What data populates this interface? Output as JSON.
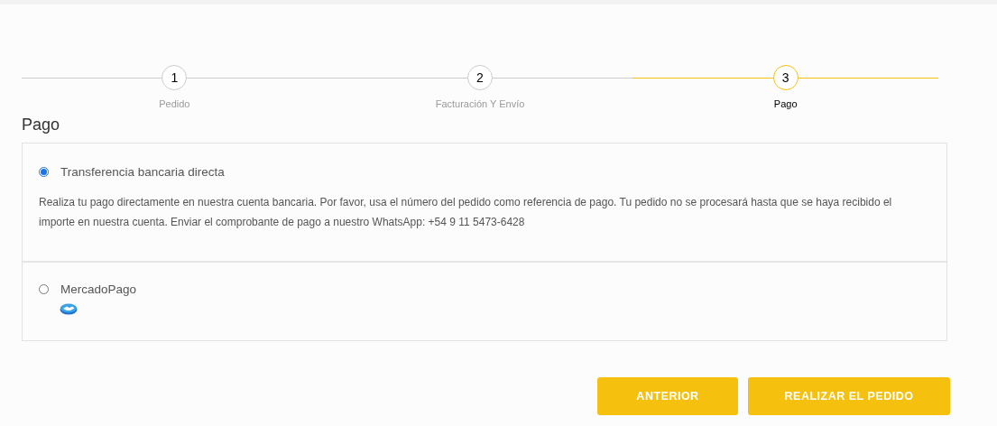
{
  "steps": [
    {
      "number": "1",
      "label": "Pedido",
      "selected": false
    },
    {
      "number": "2",
      "label": "Facturación Y Envío",
      "selected": false
    },
    {
      "number": "3",
      "label": "Pago",
      "selected": true
    }
  ],
  "section_title": "Pago",
  "payment_methods": [
    {
      "label": "Transferencia bancaria directa",
      "selected": true,
      "description": "Realiza tu pago directamente en nuestra cuenta bancaria. Por favor, usa el número del pedido como referencia de pago. Tu pedido no se procesará hasta que se haya recibido el importe en nuestra cuenta. Enviar el comprobante de pago a nuestro WhatsApp: +54 9 11 5473-6428"
    },
    {
      "label": "MercadoPago",
      "selected": false,
      "logo": true
    }
  ],
  "buttons": [
    "ANTERIOR",
    "REALIZAR EL PEDIDO"
  ]
}
